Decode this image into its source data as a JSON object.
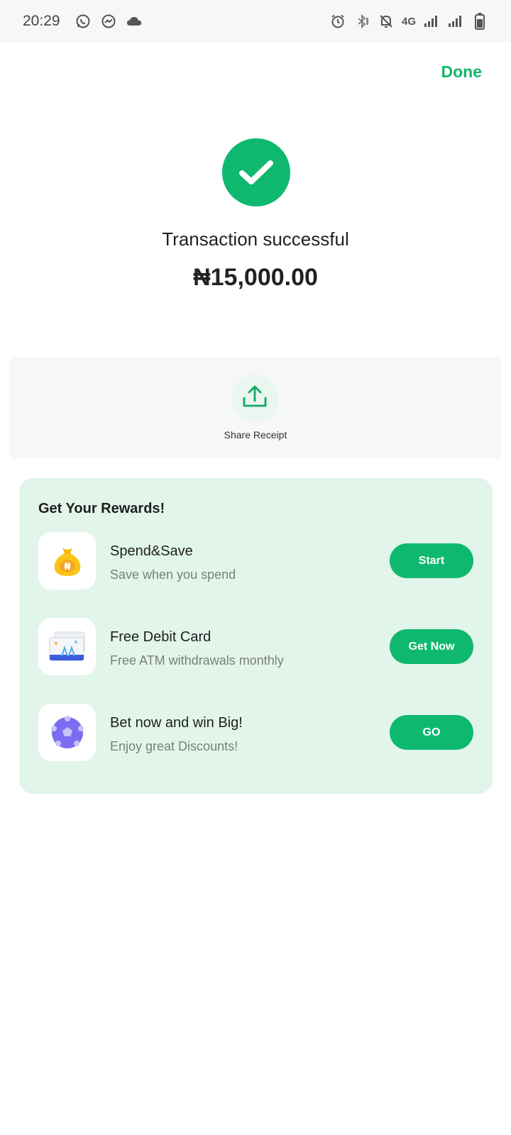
{
  "status_bar": {
    "time": "20:29",
    "network": "4G",
    "left_icons": [
      "whatsapp-icon",
      "messenger-icon",
      "cloud-icon"
    ],
    "right_icons": [
      "alarm-icon",
      "bluetooth-icon",
      "mute-icon",
      "signal-icon",
      "signal-icon",
      "battery-icon"
    ]
  },
  "header": {
    "done_label": "Done"
  },
  "transaction": {
    "status_icon": "check-icon",
    "title": "Transaction successful",
    "amount": "₦15,000.00"
  },
  "share": {
    "icon": "upload-icon",
    "label": "Share Receipt"
  },
  "rewards": {
    "title": "Get Your Rewards!",
    "items": [
      {
        "icon": "money-bag-icon",
        "title": "Spend&Save",
        "subtitle": "Save when you spend",
        "button": "Start"
      },
      {
        "icon": "debit-card-icon",
        "title": "Free Debit Card",
        "subtitle": "Free ATM withdrawals monthly",
        "button": "Get Now"
      },
      {
        "icon": "soccer-ball-icon",
        "title": "Bet now and win Big!",
        "subtitle": "Enjoy great Discounts!",
        "button": "GO"
      }
    ]
  },
  "colors": {
    "accent": "#0fb86f",
    "rewards_bg": "#e2f5ea",
    "share_bg": "#f6f7f9"
  }
}
